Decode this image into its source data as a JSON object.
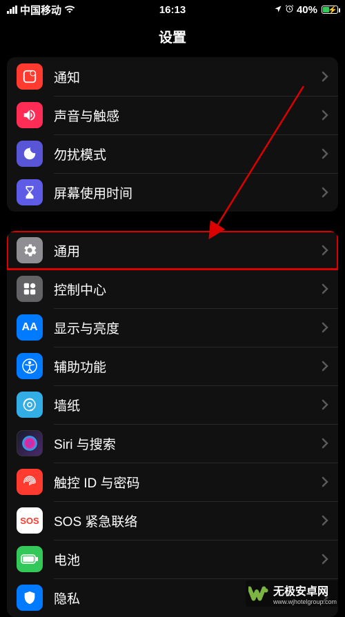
{
  "status": {
    "carrier": "中国移动",
    "time": "16:13",
    "battery": "40%"
  },
  "header": {
    "title": "设置"
  },
  "groups": [
    {
      "items": [
        {
          "name": "notifications",
          "label": "通知"
        },
        {
          "name": "sounds",
          "label": "声音与触感"
        },
        {
          "name": "dnd",
          "label": "勿扰模式"
        },
        {
          "name": "screentime",
          "label": "屏幕使用时间"
        }
      ]
    },
    {
      "items": [
        {
          "name": "general",
          "label": "通用",
          "highlight": true
        },
        {
          "name": "controlcenter",
          "label": "控制中心"
        },
        {
          "name": "display",
          "label": "显示与亮度"
        },
        {
          "name": "accessibility",
          "label": "辅助功能"
        },
        {
          "name": "wallpaper",
          "label": "墙纸"
        },
        {
          "name": "siri",
          "label": "Siri 与搜索"
        },
        {
          "name": "touchid",
          "label": "触控 ID 与密码"
        },
        {
          "name": "sos",
          "label": "SOS 紧急联络",
          "iconText": "SOS"
        },
        {
          "name": "battery",
          "label": "电池"
        },
        {
          "name": "privacy",
          "label": "隐私"
        }
      ]
    }
  ],
  "watermark": {
    "title": "无极安卓网",
    "url": "www.wjhotelgroup.com"
  }
}
